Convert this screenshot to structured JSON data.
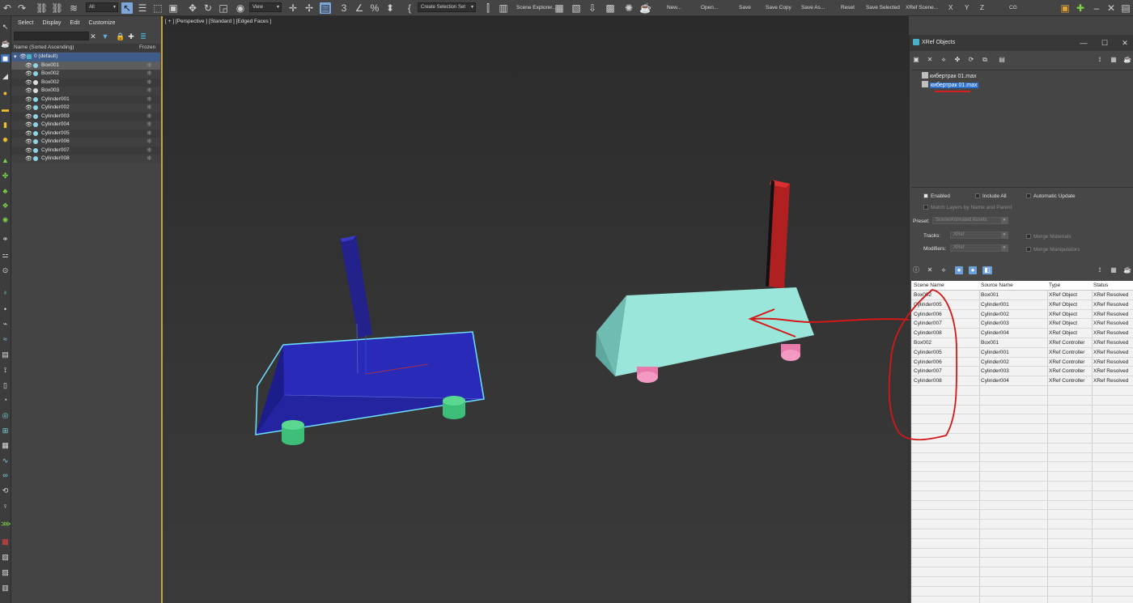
{
  "toolbar": {
    "selection_filter": "All",
    "ref_coord": "View",
    "selection_set": "Create Selection Set",
    "scene_explorer_label": "Scene Explorer...",
    "buttons": [
      "New...",
      "Open...",
      "Save",
      "Save Copy",
      "Save As...",
      "Reset",
      "Save Selected",
      "XRef Scene...",
      "X",
      "Y",
      "Z",
      "CG"
    ]
  },
  "explorer": {
    "menu": [
      "Select",
      "Display",
      "Edit",
      "Customize"
    ],
    "header_name": "Name (Sorted Ascending)",
    "header_frozen": "Frozen",
    "layer": "0 (default)",
    "items": [
      "Box001",
      "Box002",
      "Box002",
      "Box003",
      "Cylinder001",
      "Cylinder002",
      "Cylinder003",
      "Cylinder004",
      "Cylinder005",
      "Cylinder006",
      "Cylinder007",
      "Cylinder008"
    ]
  },
  "viewport": {
    "label": "[ + ] [Perspective ] [Standard ] [Edged Faces ]"
  },
  "xref": {
    "title": "XRef Objects",
    "files": [
      "кибертрак 01.max",
      "кибертрак 01.max"
    ],
    "options": {
      "enabled": "Enabled",
      "include_all": "Include All",
      "automatic_update": "Automatic Update",
      "match_layers": "Match Layers by Name and Parent",
      "preset_label": "Preset:",
      "preset_value": "Scene/Animated Assets",
      "tracks_label": "Tracks:",
      "tracks_value": "XRef",
      "modifiers_label": "Modifiers:",
      "modifiers_value": "XRef",
      "merge_materials": "Merge Materials",
      "merge_manipulators": "Merge Manipulators"
    },
    "table": {
      "columns": [
        "Scene Name",
        "Source Name",
        "Type",
        "Status"
      ],
      "rows": [
        [
          "Box002",
          "Box001",
          "XRef Object",
          "XRef Resolved"
        ],
        [
          "Cylinder005",
          "Cylinder001",
          "XRef Object",
          "XRef Resolved"
        ],
        [
          "Cylinder006",
          "Cylinder002",
          "XRef Object",
          "XRef Resolved"
        ],
        [
          "Cylinder007",
          "Cylinder003",
          "XRef Object",
          "XRef Resolved"
        ],
        [
          "Cylinder008",
          "Cylinder004",
          "XRef Object",
          "XRef Resolved"
        ],
        [
          "Box002",
          "Box001",
          "XRef Controller",
          "XRef Resolved"
        ],
        [
          "Cylinder005",
          "Cylinder001",
          "XRef Controller",
          "XRef Resolved"
        ],
        [
          "Cylinder006",
          "Cylinder002",
          "XRef Controller",
          "XRef Resolved"
        ],
        [
          "Cylinder007",
          "Cylinder003",
          "XRef Controller",
          "XRef Resolved"
        ],
        [
          "Cylinder008",
          "Cylinder004",
          "XRef Controller",
          "XRef Resolved"
        ]
      ]
    }
  }
}
